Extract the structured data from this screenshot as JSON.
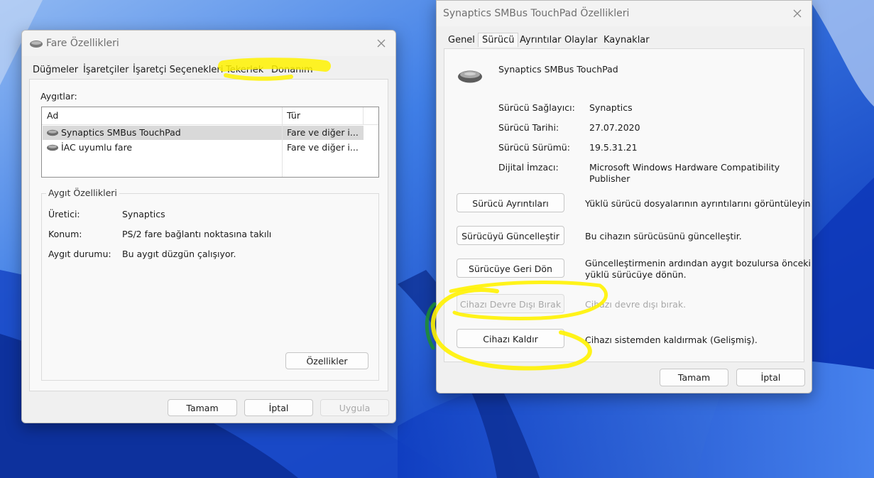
{
  "colors": {
    "wallpaper_base": "#2a63d8",
    "highlighter": "#fff200",
    "highlighter_green": "#1c8f2c"
  },
  "mouse_dialog": {
    "title": "Fare Özellikleri",
    "title_icon": "mouse-icon",
    "tabs": [
      "Düğmeler",
      "İşaretçiler",
      "İşaretçi Seçenekleri",
      "Tekerlek",
      "Donanım"
    ],
    "devices_label": "Aygıtlar:",
    "columns": [
      "Ad",
      "Tür"
    ],
    "devices": [
      {
        "name": "Synaptics SMBus TouchPad",
        "type": "Fare ve diğer i...",
        "icon": "mouse-icon"
      },
      {
        "name": "İAC uyumlu fare",
        "type": "Fare ve diğer i...",
        "icon": "mouse-icon"
      }
    ],
    "group_title": "Aygıt Özellikleri",
    "props": [
      {
        "key": "Üretici:",
        "value": "Synaptics"
      },
      {
        "key": "Konum:",
        "value": "PS/2 fare bağlantı noktasına takılı"
      },
      {
        "key": "Aygıt durumu:",
        "value": "Bu aygıt düzgün çalışıyor."
      }
    ],
    "properties_button": "Özellikler",
    "ok": "Tamam",
    "cancel": "İptal",
    "apply": "Uygula"
  },
  "driver_dialog": {
    "title": "Synaptics SMBus TouchPad Özellikleri",
    "tabs": [
      "Genel",
      "Sürücü",
      "Ayrıntılar",
      "Olaylar",
      "Kaynaklar"
    ],
    "device_name": "Synaptics SMBus TouchPad",
    "device_icon": "touchpad-mouse-icon",
    "info": [
      {
        "key": "Sürücü Sağlayıcı:",
        "value": "Synaptics"
      },
      {
        "key": "Sürücü Tarihi:",
        "value": "27.07.2020"
      },
      {
        "key": "Sürücü Sürümü:",
        "value": "19.5.31.21"
      },
      {
        "key": "Dijital İmzacı:",
        "value_line1": "Microsoft Windows Hardware Compatibility",
        "value_line2": "Publisher"
      }
    ],
    "actions": [
      {
        "button": "Sürücü Ayrıntıları",
        "desc": "Yüklü sürücü dosyalarının ayrıntılarını görüntüleyin."
      },
      {
        "button": "Sürücüyü Güncelleştir",
        "desc": "Bu cihazın sürücüsünü güncelleştir."
      },
      {
        "button": "Sürücüye Geri Dön",
        "desc_line1": "Güncelleştirmenin ardından aygıt bozulursa önceki",
        "desc_line2": "yüklü sürücüye dönün."
      },
      {
        "button": "Cihazı Devre Dışı Bırak",
        "desc": "Cihazı devre dışı bırak."
      },
      {
        "button": "Cihazı Kaldır",
        "desc": "Cihazı sistemden kaldırmak (Gelişmiş)."
      }
    ],
    "ok": "Tamam",
    "cancel": "İptal"
  }
}
